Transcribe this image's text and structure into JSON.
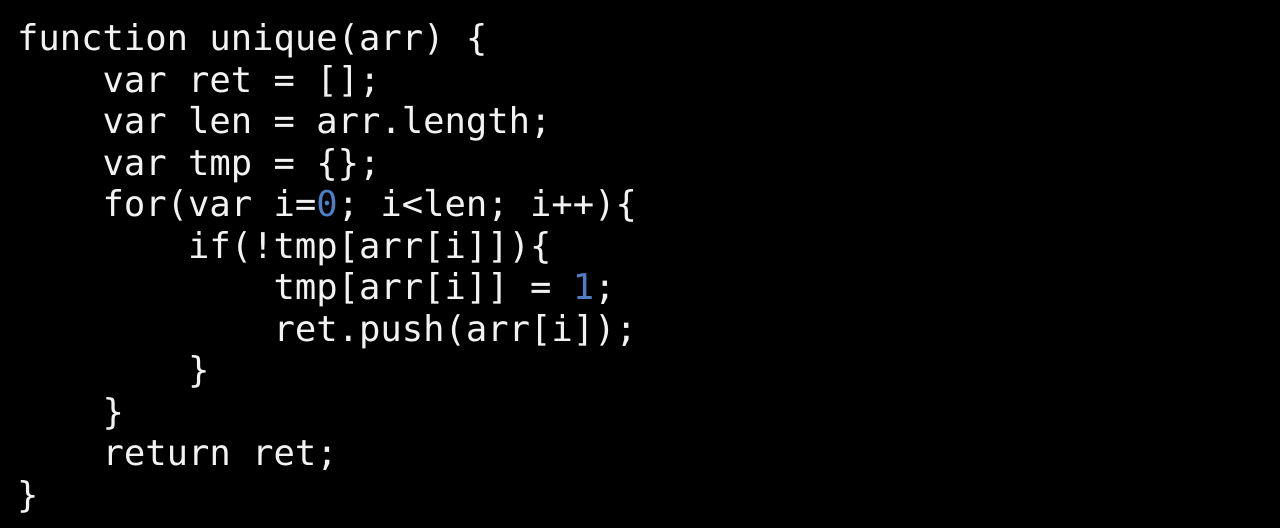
{
  "editor": {
    "background_color": "#000000",
    "foreground_color": "#f2f2f2",
    "number_literal_color": "#4f7ec4",
    "language": "javascript",
    "function_name": "unique"
  },
  "code": {
    "full_text": "function unique(arr) {\n    var ret = [];\n    var len = arr.length;\n    var tmp = {};\n    for(var i=0; i<len; i++){\n        if(!tmp[arr[i]]){\n            tmp[arr[i]] = 1;\n            ret.push(arr[i]);\n        }\n    }\n    return ret;\n}",
    "lines": [
      {
        "text": "function unique(arr) {",
        "indent": 0
      },
      {
        "text": "var ret = [];",
        "indent": 4
      },
      {
        "text": "var len = arr.length;",
        "indent": 4
      },
      {
        "text": "var tmp = {};",
        "indent": 4
      },
      {
        "text": "for(var i=",
        "indent": 4,
        "num": "0",
        "after": "; i<len; i++){"
      },
      {
        "text": "if(!tmp[arr[i]]){",
        "indent": 8
      },
      {
        "text": "tmp[arr[i]] = ",
        "indent": 12,
        "num": "1",
        "after": ";"
      },
      {
        "text": "ret.push(arr[i]);",
        "indent": 12
      },
      {
        "text": "}",
        "indent": 8
      },
      {
        "text": "}",
        "indent": 4
      },
      {
        "text": "return ret;",
        "indent": 4
      },
      {
        "text": "}",
        "indent": 0
      }
    ],
    "line_01": "function unique(arr) {",
    "line_02": "    var ret = [];",
    "line_03": "    var len = arr.length;",
    "line_04": "    var tmp = {};",
    "line_05_pre": "    for(var i=",
    "line_05_num": "0",
    "line_05_post": "; i<len; i++){",
    "line_06": "        if(!tmp[arr[i]]){",
    "line_07_pre": "            tmp[arr[i]] = ",
    "line_07_num": "1",
    "line_07_post": ";",
    "line_08": "            ret.push(arr[i]);",
    "line_09": "        }",
    "line_10": "    }",
    "line_11": "    return ret;",
    "line_12": "}"
  }
}
